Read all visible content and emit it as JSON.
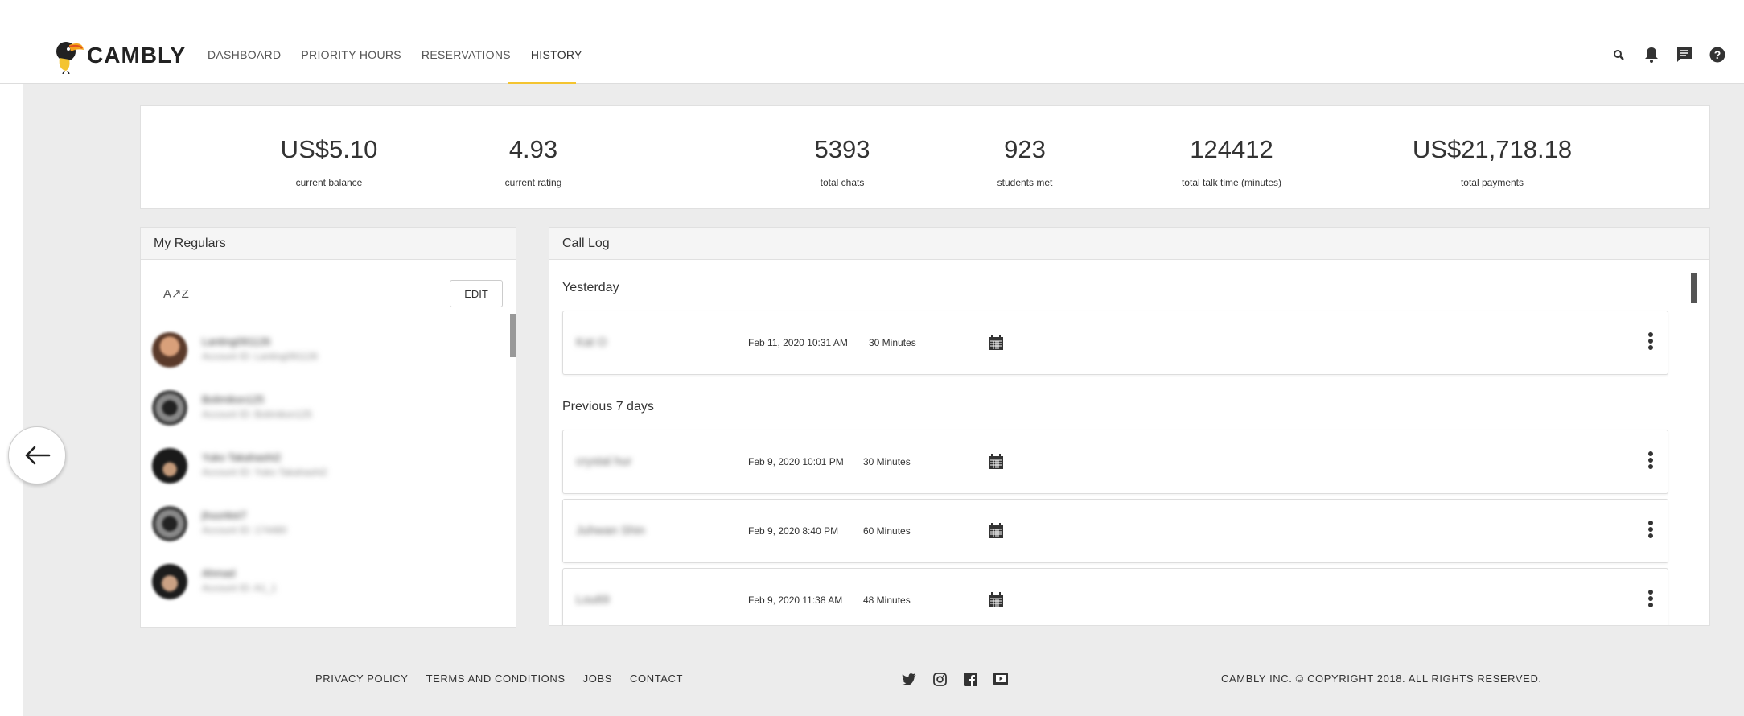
{
  "brand": {
    "name": "CAMBLY",
    "accent": "#f4c430"
  },
  "nav": {
    "items": [
      "DASHBOARD",
      "PRIORITY HOURS",
      "RESERVATIONS",
      "HISTORY"
    ],
    "active": "HISTORY"
  },
  "top_icons": [
    "search-icon",
    "bell-icon",
    "chat-icon",
    "help-icon"
  ],
  "stats": [
    {
      "value": "US$5.10",
      "label": "current balance"
    },
    {
      "value": "4.93",
      "label": "current rating"
    },
    {
      "value": "5393",
      "label": "total chats"
    },
    {
      "value": "923",
      "label": "students met"
    },
    {
      "value": "124412",
      "label": "total talk time (minutes)"
    },
    {
      "value": "US$21,718.18",
      "label": "total payments"
    }
  ],
  "regulars": {
    "title": "My Regulars",
    "sort_label": "A↗Z",
    "edit_label": "EDIT",
    "items": [
      {
        "name": "Lanting091126",
        "account": "Account ID: Lanting091126"
      },
      {
        "name": "Bolimiksn125",
        "account": "Account ID: Bolimiksn125"
      },
      {
        "name": "Yuko Takahashi2",
        "account": "Account ID: Yuko Takahashi2"
      },
      {
        "name": "jhuunkei7",
        "account": "Account ID: 174480"
      },
      {
        "name": "Ahmad",
        "account": "Account ID: A1_1"
      }
    ]
  },
  "call_log": {
    "title": "Call Log",
    "groups": [
      {
        "title": "Yesterday",
        "calls": [
          {
            "name": "Kat O",
            "date": "Feb 11, 2020 10:31 AM",
            "duration": "30 Minutes"
          }
        ]
      },
      {
        "title": "Previous 7 days",
        "calls": [
          {
            "name": "crystal hur",
            "date": "Feb 9, 2020 10:01 PM",
            "duration": "30 Minutes"
          },
          {
            "name": "Juhwan Shin",
            "date": "Feb 9, 2020 8:40 PM",
            "duration": "60 Minutes"
          },
          {
            "name": "Lou69",
            "date": "Feb 9, 2020 11:38 AM",
            "duration": "48 Minutes"
          }
        ]
      }
    ]
  },
  "footer": {
    "links": [
      "PRIVACY POLICY",
      "TERMS AND CONDITIONS",
      "JOBS",
      "CONTACT"
    ],
    "social": [
      "twitter-icon",
      "instagram-icon",
      "facebook-icon",
      "youtube-icon"
    ],
    "copyright": "CAMBLY INC. © COPYRIGHT 2018. ALL RIGHTS RESERVED."
  }
}
